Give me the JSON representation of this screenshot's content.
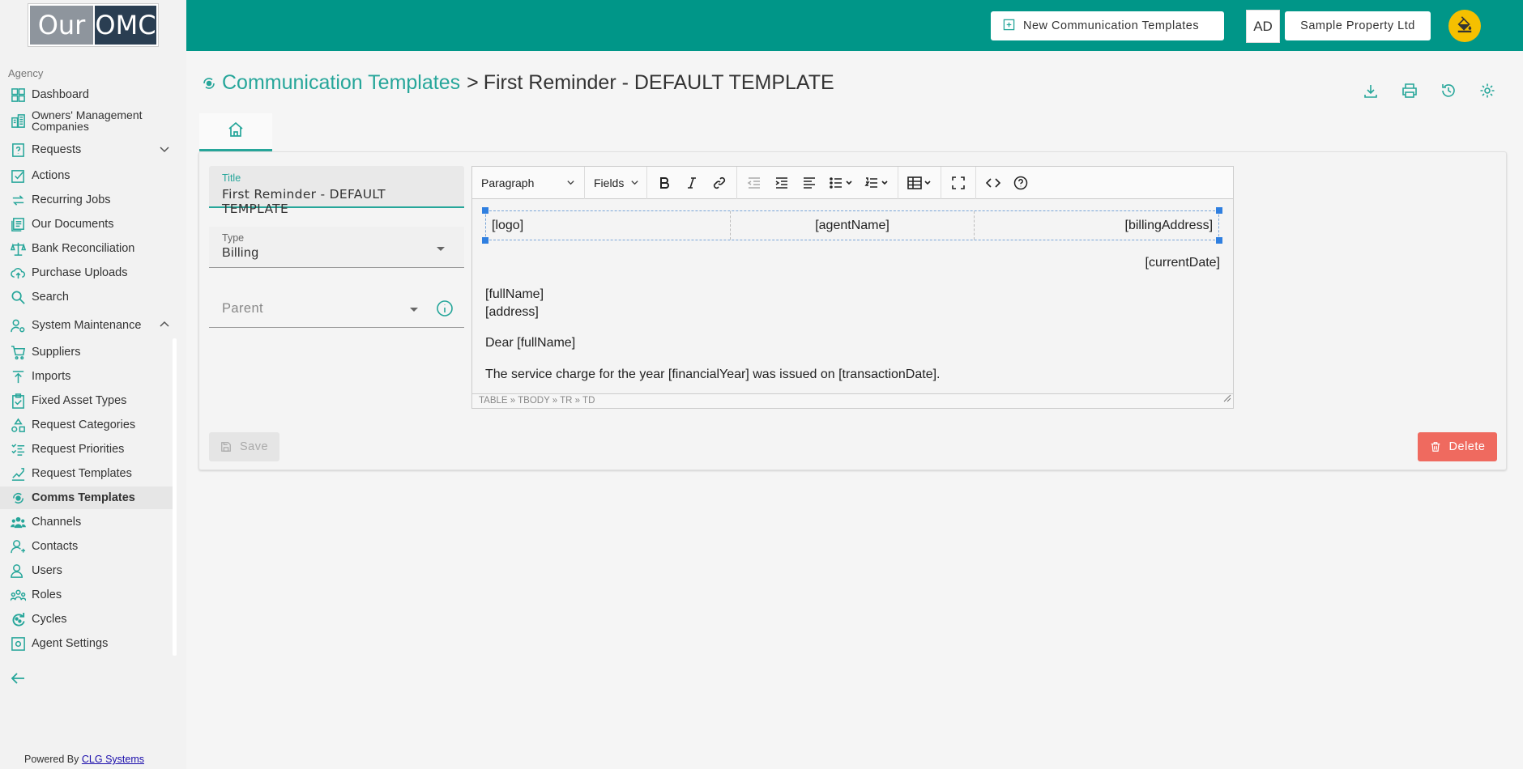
{
  "brand": {
    "logo_left": "Our",
    "logo_right": "OMC"
  },
  "sidebar": {
    "group_label": "Agency",
    "items": [
      {
        "label": "Dashboard",
        "icon": "dashboard-icon"
      },
      {
        "label": "Owners' Management Companies",
        "icon": "buildings-icon"
      },
      {
        "label": "Requests",
        "icon": "request-icon"
      },
      {
        "label": "Actions",
        "icon": "checkbox-icon"
      },
      {
        "label": "Recurring Jobs",
        "icon": "repeat-icon"
      },
      {
        "label": "Our Documents",
        "icon": "documents-icon"
      },
      {
        "label": "Bank Reconciliation",
        "icon": "scales-icon"
      },
      {
        "label": "Purchase Uploads",
        "icon": "cloud-upload-icon"
      },
      {
        "label": "Search",
        "icon": "search-icon"
      },
      {
        "label": "System Maintenance",
        "icon": "user-gear-icon"
      },
      {
        "label": "Suppliers",
        "icon": "cart-icon"
      },
      {
        "label": "Imports",
        "icon": "import-icon"
      },
      {
        "label": "Fixed Asset Types",
        "icon": "clipboard-icon"
      },
      {
        "label": "Request Categories",
        "icon": "categories-icon"
      },
      {
        "label": "Request Priorities",
        "icon": "priorities-icon"
      },
      {
        "label": "Request Templates",
        "icon": "templates-icon"
      },
      {
        "label": "Comms Templates",
        "icon": "comms-icon"
      },
      {
        "label": "Channels",
        "icon": "group-icon"
      },
      {
        "label": "Contacts",
        "icon": "contacts-icon"
      },
      {
        "label": "Users",
        "icon": "users-icon"
      },
      {
        "label": "Roles",
        "icon": "roles-icon"
      },
      {
        "label": "Cycles",
        "icon": "cycle-icon"
      },
      {
        "label": "Agent Settings",
        "icon": "settings-icon"
      }
    ],
    "powered_by": "Powered By",
    "powered_link": "CLG Systems"
  },
  "topbar": {
    "new_button": "New Communication Templates",
    "avatar": "AD",
    "company": "Sample Property Ltd"
  },
  "header": {
    "crumb_link": "Communication Templates",
    "separator": ">",
    "crumb_current": "First Reminder - DEFAULT TEMPLATE"
  },
  "form": {
    "title_label": "Title",
    "title_value": "First Reminder - DEFAULT TEMPLATE",
    "type_label": "Type",
    "type_value": "Billing",
    "parent_placeholder": "Parent"
  },
  "editor": {
    "block_format": "Paragraph",
    "fields_menu": "Fields",
    "header_cells": [
      "[logo]",
      "[agentName]",
      "[billingAddress]"
    ],
    "current_date": "[currentDate]",
    "full_name": "[fullName]",
    "address": "[address]",
    "greeting": "Dear [fullName]",
    "body": "The service charge for the year [financialYear] was issued on [transactionDate].",
    "status_path": "TABLE » TBODY » TR » TD"
  },
  "actions": {
    "save": "Save",
    "delete": "Delete"
  },
  "colors": {
    "primary": "#009688",
    "accent_text": "#26a69a",
    "danger": "#ef6a5f",
    "theme_button": "#f5c000"
  }
}
